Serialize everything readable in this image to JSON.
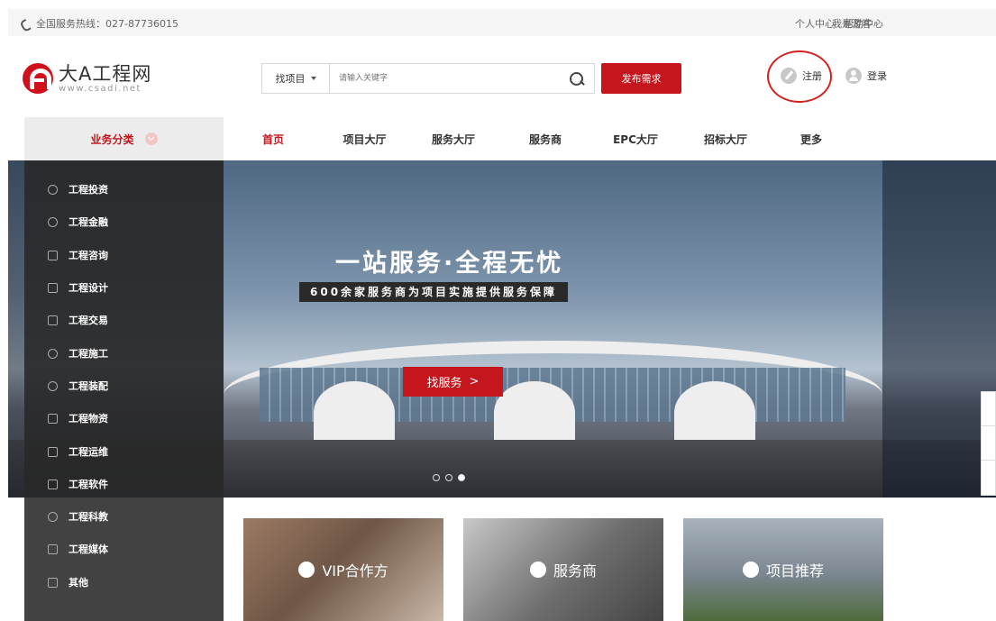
{
  "topbar": {
    "hotline": "全国服务热线：027-87736015",
    "links": [
      "个人中心",
      "帮助中心"
    ],
    "guest": "我是游客"
  },
  "logo": {
    "cn": "大A工程网",
    "en": "www.csadi.net"
  },
  "search": {
    "type": "找项目",
    "placeholder": "请输入关键字"
  },
  "publish_label": "发布需求",
  "auth": {
    "register": "注册",
    "login": "登录"
  },
  "nav": {
    "category": "业务分类",
    "items": [
      "首页",
      "项目大厅",
      "服务大厅",
      "服务商",
      "EPC大厅",
      "招标大厅",
      "更多"
    ],
    "active_color": "#c4161c"
  },
  "banner": {
    "slogan": "一站服务·全程无忧",
    "subslogan": "600余家服务商为项目实施提供服务保障",
    "cta": "找服务",
    "cta_arrow": ">"
  },
  "sidemenu": [
    "工程投资",
    "工程金融",
    "工程咨询",
    "工程设计",
    "工程交易",
    "工程施工",
    "工程装配",
    "工程物资",
    "工程运维",
    "工程软件",
    "工程科教",
    "工程媒体",
    "其他"
  ],
  "cards": [
    "VIP合作方",
    "服务商",
    "项目推荐"
  ],
  "colors": {
    "brand": "#c4161c"
  }
}
